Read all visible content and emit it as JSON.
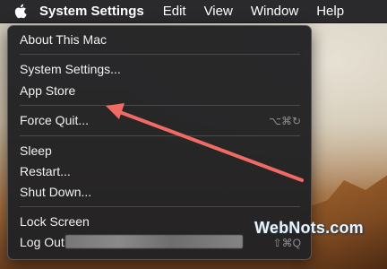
{
  "menubar": {
    "apple_icon": "apple-logo-icon",
    "app_name": "System Settings",
    "items": [
      "Edit",
      "View",
      "Window",
      "Help"
    ]
  },
  "apple_menu": {
    "items": [
      {
        "label": "About This Mac"
      },
      {
        "label": "System Settings..."
      },
      {
        "label": "App Store"
      },
      {
        "label": "Force Quit...",
        "shortcut": "⌥⌘↻"
      },
      {
        "label": "Sleep"
      },
      {
        "label": "Restart..."
      },
      {
        "label": "Shut Down..."
      },
      {
        "label": "Lock Screen"
      },
      {
        "label": "Log Out",
        "shortcut": "⇧⌘Q"
      }
    ]
  },
  "annotation": {
    "arrow_color": "#f16a64"
  },
  "watermark": "WebNots.com"
}
